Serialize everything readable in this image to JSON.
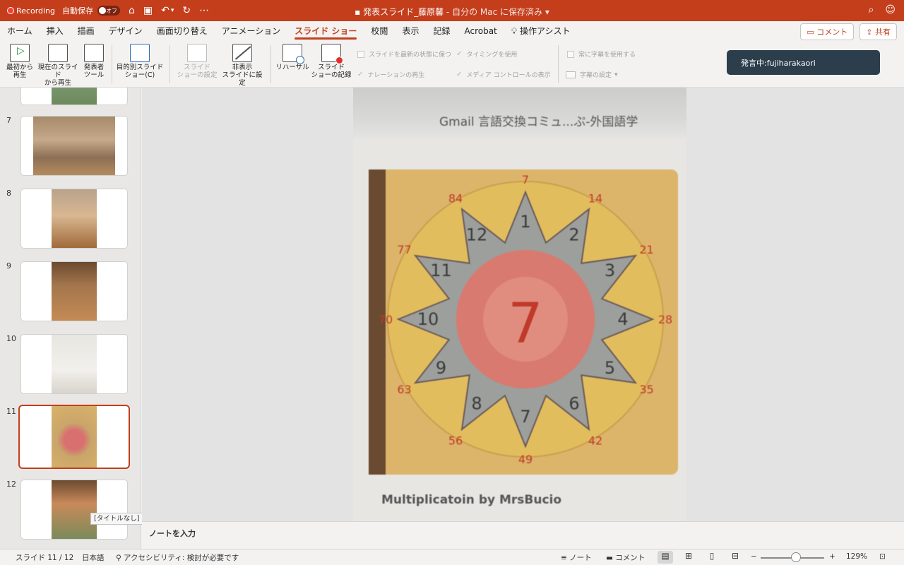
{
  "titlebar": {
    "recording": "Recording",
    "autosave": "自動保存",
    "autosave_state": "オフ",
    "doc_title": "発表スライド_藤原馨",
    "doc_saved": " - 自分の Mac に保存済み",
    "icons": [
      "home-icon",
      "save-icon",
      "undo-icon",
      "redo-icon",
      "more-icon",
      "search-icon",
      "person-icon"
    ]
  },
  "tabs": [
    "ホーム",
    "挿入",
    "描画",
    "デザイン",
    "画面切り替え",
    "アニメーション",
    "スライド ショー",
    "校閲",
    "表示",
    "記録",
    "Acrobat",
    "操作アシスト"
  ],
  "active_tab": "スライド ショー",
  "tab_buttons": {
    "comment": "コメント",
    "share": "共有"
  },
  "ribbon": {
    "from_start": [
      "最初から",
      "再生"
    ],
    "from_current": [
      "現在のスライド",
      "から再生"
    ],
    "presenter": [
      "発表者",
      "ツール"
    ],
    "custom_show": [
      "目的別スライド",
      "ショー(C)"
    ],
    "setup_show": [
      "スライド",
      "ショーの設定"
    ],
    "hide_slide": [
      "非表示",
      "スライドに設定"
    ],
    "rehearse": [
      "リハーサル"
    ],
    "record": [
      "スライド",
      "ショーの記録"
    ],
    "keep_updated": "スライドを最新の状態に保つ",
    "use_timings": "タイミングを使用",
    "play_narration": "ナレーションの再生",
    "show_media_controls": "メディア コントロールの表示",
    "always_subtitles": "常に字幕を使用する",
    "subtitle_settings": "字幕の設定"
  },
  "toast": "発言中:fujiharakaori",
  "thumbnails": [
    {
      "num": "7"
    },
    {
      "num": "8"
    },
    {
      "num": "9"
    },
    {
      "num": "10"
    },
    {
      "num": "11",
      "selected": true
    },
    {
      "num": "12"
    }
  ],
  "tooltip": "[タイトルなし]",
  "slide": {
    "browser_tabs": "Gmail    言語交換コミュ...ぷ-外国語学",
    "center_number": "7",
    "segment_numbers": [
      "1",
      "2",
      "3",
      "4",
      "5",
      "6",
      "7",
      "8",
      "9",
      "10",
      "11",
      "12"
    ],
    "outer_numbers": [
      "7",
      "14",
      "21",
      "28",
      "35",
      "42",
      "49",
      "56",
      "63",
      "70",
      "77",
      "84"
    ],
    "caption": "Multiplicatoin by MrsBucio"
  },
  "notes_placeholder": "ノートを入力",
  "status": {
    "slide_pos": "スライド 11 / 12",
    "language": "日本語",
    "accessibility": "アクセシビリティ: 検討が必要です",
    "notes": "ノート",
    "comments": "コメント",
    "zoom": "129%"
  }
}
